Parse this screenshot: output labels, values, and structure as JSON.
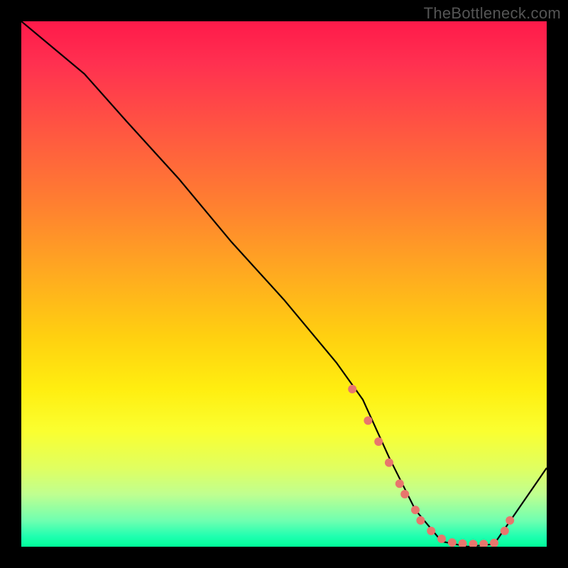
{
  "watermark": "TheBottleneck.com",
  "chart_data": {
    "type": "line",
    "title": "",
    "xlabel": "",
    "ylabel": "",
    "xlim": [
      0,
      100
    ],
    "ylim": [
      0,
      100
    ],
    "curve": {
      "x": [
        0,
        6,
        12,
        20,
        30,
        40,
        50,
        60,
        65,
        70,
        75,
        80,
        85,
        90,
        100
      ],
      "y": [
        100,
        95,
        90,
        81,
        70,
        58,
        47,
        35,
        28,
        17,
        7,
        1,
        0,
        0.5,
        15
      ]
    },
    "markers": {
      "x": [
        63,
        66,
        68,
        70,
        72,
        73,
        75,
        76,
        78,
        80,
        82,
        84,
        86,
        88,
        90,
        92,
        93
      ],
      "y": [
        30,
        24,
        20,
        16,
        12,
        10,
        7,
        5,
        3,
        1.5,
        0.8,
        0.6,
        0.5,
        0.5,
        0.7,
        3,
        5
      ]
    },
    "marker_color": "#e8766d",
    "line_color": "#000000"
  }
}
